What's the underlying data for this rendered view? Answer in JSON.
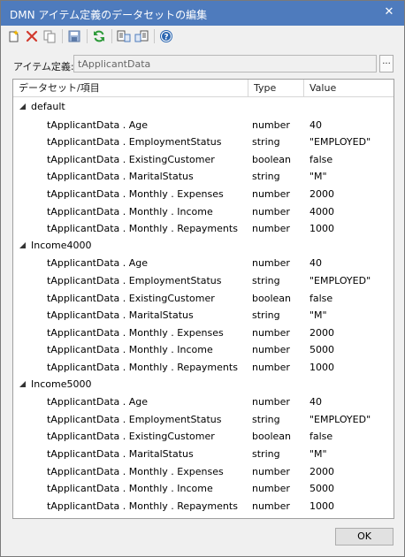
{
  "window": {
    "title": "DMN アイテム定義のデータセットの編集",
    "close_glyph": "✕"
  },
  "toolbar": {
    "buttons": [
      {
        "icon": "new-icon"
      },
      {
        "icon": "delete-icon"
      },
      {
        "icon": "copy-icon"
      },
      {
        "icon": "save-icon"
      },
      {
        "icon": "refresh-icon"
      },
      {
        "icon": "export-icon"
      },
      {
        "icon": "import-icon"
      },
      {
        "icon": "help-icon"
      }
    ]
  },
  "item_definition": {
    "label": "アイテム定義:",
    "value": "tApplicantData",
    "browse_label": "..."
  },
  "grid": {
    "columns": [
      "データセット/項目",
      "Type",
      "Value"
    ],
    "groups": [
      {
        "name": "default",
        "items": [
          {
            "name": "tApplicantData . Age",
            "type": "number",
            "value": "40"
          },
          {
            "name": "tApplicantData . EmploymentStatus",
            "type": "string",
            "value": "\"EMPLOYED\""
          },
          {
            "name": "tApplicantData . ExistingCustomer",
            "type": "boolean",
            "value": "false"
          },
          {
            "name": "tApplicantData . MaritalStatus",
            "type": "string",
            "value": "\"M\""
          },
          {
            "name": "tApplicantData . Monthly . Expenses",
            "type": "number",
            "value": "2000"
          },
          {
            "name": "tApplicantData . Monthly . Income",
            "type": "number",
            "value": "4000"
          },
          {
            "name": "tApplicantData . Monthly . Repayments",
            "type": "number",
            "value": "1000"
          }
        ]
      },
      {
        "name": "Income4000",
        "items": [
          {
            "name": "tApplicantData . Age",
            "type": "number",
            "value": "40"
          },
          {
            "name": "tApplicantData . EmploymentStatus",
            "type": "string",
            "value": "\"EMPLOYED\""
          },
          {
            "name": "tApplicantData . ExistingCustomer",
            "type": "boolean",
            "value": "false"
          },
          {
            "name": "tApplicantData . MaritalStatus",
            "type": "string",
            "value": "\"M\""
          },
          {
            "name": "tApplicantData . Monthly . Expenses",
            "type": "number",
            "value": "2000"
          },
          {
            "name": "tApplicantData . Monthly . Income",
            "type": "number",
            "value": "5000"
          },
          {
            "name": "tApplicantData . Monthly . Repayments",
            "type": "number",
            "value": "1000"
          }
        ]
      },
      {
        "name": "Income5000",
        "items": [
          {
            "name": "tApplicantData . Age",
            "type": "number",
            "value": "40"
          },
          {
            "name": "tApplicantData . EmploymentStatus",
            "type": "string",
            "value": "\"EMPLOYED\""
          },
          {
            "name": "tApplicantData . ExistingCustomer",
            "type": "boolean",
            "value": "false"
          },
          {
            "name": "tApplicantData . MaritalStatus",
            "type": "string",
            "value": "\"M\""
          },
          {
            "name": "tApplicantData . Monthly . Expenses",
            "type": "number",
            "value": "2000"
          },
          {
            "name": "tApplicantData . Monthly . Income",
            "type": "number",
            "value": "5000"
          },
          {
            "name": "tApplicantData . Monthly . Repayments",
            "type": "number",
            "value": "1000"
          }
        ]
      }
    ]
  },
  "footer": {
    "ok_label": "OK"
  },
  "colors": {
    "titlebar": "#4e7bbd",
    "background": "#f0f0f0"
  }
}
